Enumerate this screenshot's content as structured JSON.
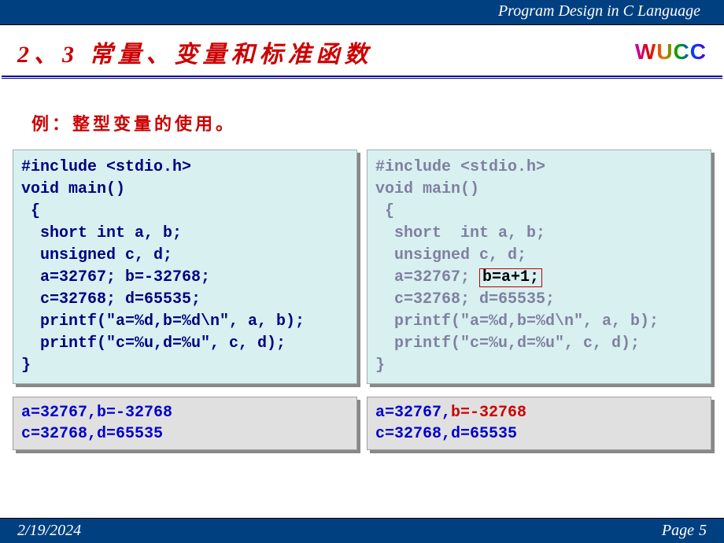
{
  "header": {
    "title": "Program Design in C Language"
  },
  "section": {
    "title": "2、3  常量、变量和标准函数",
    "logo": "WUCC"
  },
  "example": {
    "label": "例：整型变量的使用。"
  },
  "code_left": {
    "l1": "#include <stdio.h>",
    "l2": "void main()",
    "l3": " {",
    "l4": "  short int a, b;",
    "l5": "  unsigned c, d;",
    "l6": "  a=32767; b=-32768;",
    "l7": "  c=32768; d=65535;",
    "l8": "  printf(\"a=%d,b=%d\\n\", a, b);",
    "l9": "  printf(\"c=%u,d=%u\", c, d);",
    "l10": "}"
  },
  "code_right": {
    "l1": "#include <stdio.h>",
    "l2": "void main()",
    "l3": " {",
    "l4": "  short  int a, b;",
    "l5": "  unsigned c, d;",
    "l6a": "  a=32767; ",
    "l6b_hl": "b=a+1;",
    "l7": "  c=32768; d=65535;",
    "l8": "  printf(\"a=%d,b=%d\\n\", a, b);",
    "l9": "  printf(\"c=%u,d=%u\", c, d);",
    "l10": "}"
  },
  "out_left": {
    "o1": "a=32767,b=-32768",
    "o2": "c=32768,d=65535"
  },
  "out_right": {
    "o1a": "a=32767,",
    "o1b": "b=-32768",
    "o2": "c=32768,d=65535"
  },
  "footer": {
    "date": "2/19/2024",
    "page_label": "Page",
    "page_num": "5"
  }
}
